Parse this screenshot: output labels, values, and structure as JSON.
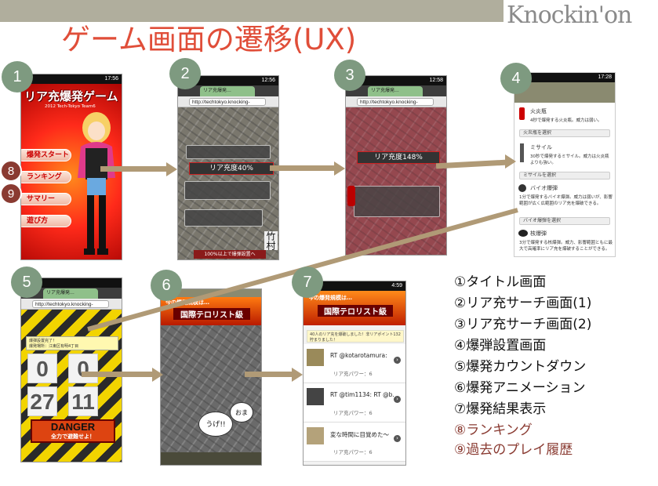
{
  "slide": {
    "title": "ゲーム画面の遷移(UX)",
    "logo": "Knockin'on"
  },
  "markers": [
    "1",
    "2",
    "3",
    "4",
    "5",
    "6",
    "7"
  ],
  "side_markers": [
    "8",
    "9"
  ],
  "legend": [
    "①タイトル画面",
    "②リア充サーチ画面(1)",
    "③リア充サーチ画面(2)",
    "④爆弾設置画面",
    "⑤爆発カウントダウン",
    "⑥爆発アニメーション",
    "⑦爆発結果表示",
    "⑧ランキング",
    "⑨過去のプレイ履歴"
  ],
  "screen1": {
    "status_time": "17:56",
    "game_title": "リア充爆発ゲーム",
    "subtitle": "2012 Tech-Tokyo Team6",
    "menu": [
      "爆発スタート",
      "ランキング",
      "サマリー",
      "遊び方"
    ]
  },
  "screen2": {
    "status_time": "12:56",
    "tab": "リア充爆発…",
    "url": "http://techtokyo.knocking-",
    "level": "リア充度40%",
    "signature": "竹村",
    "footer": "100%以上で爆弾設置へ"
  },
  "screen3": {
    "status_time": "12:58",
    "tab": "リア充爆発…",
    "url": "http://techtokyo.knocking-",
    "level": "リア充度148%"
  },
  "screen4": {
    "status_time": "17:28",
    "weapons": [
      {
        "name": "火炎瓶",
        "desc": "4秒で爆発する火炎瓶。威力は弱い。",
        "button": "火炎瓶を選択"
      },
      {
        "name": "ミサイル",
        "desc": "30秒で爆発するミサイル。威力は火炎瓶よりも強い。",
        "button": "ミサイルを選択"
      },
      {
        "name": "バイオ爆弾",
        "desc": "1分で爆発するバイオ爆弾。威力は弱いが、影響範囲が広く広範囲のリア充を爆破できる。",
        "button": "バイオ爆弾を選択"
      },
      {
        "name": "核爆弾",
        "desc": "3分で爆発する核爆弾。威力、影響範囲ともに最大で高確率にリア充を爆破することができる。",
        "button": ""
      }
    ]
  },
  "screen5": {
    "tab": "リア充爆発…",
    "url": "http://techtokyo.knocking-",
    "info": [
      "爆弾設置完了！",
      "爆発場所：江東区有明4丁目"
    ],
    "digits": [
      "0",
      "0",
      "27",
      "11"
    ],
    "danger": "DANGER",
    "danger_sub": "全力で避難せよ！"
  },
  "screen6": {
    "banner_top": "今の爆発規模は…",
    "banner_main": "国際テロリスト級",
    "bubble1": "うげ!!",
    "bubble2": "おま"
  },
  "screen7": {
    "status_time": "4:59",
    "banner_top": "今の爆発規模は…",
    "banner_main": "国際テロリスト級",
    "notice": "40人のリア充を爆破しました！非リアポイント132貯まりました！",
    "rows": [
      {
        "name": "RT @kotarotamura:",
        "power": "リア充パワー：6"
      },
      {
        "name": "RT @tim1134: RT @b.",
        "power": "リア充パワー：6"
      },
      {
        "name": "変な時間に目覚めた～",
        "power": "リア充パワー：6"
      }
    ]
  }
}
